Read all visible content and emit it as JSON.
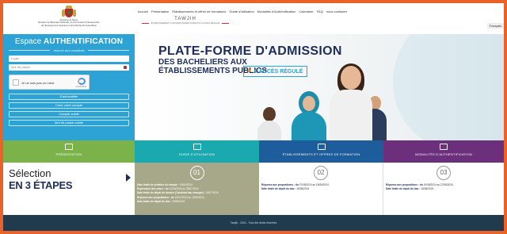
{
  "logo": {
    "lines": [
      "Royaume du Maroc",
      "Ministère de l'Éducation Nationale, de la Formation Professionnelle,",
      "de l'Enseignement Supérieur et de la Recherche Scientifique"
    ]
  },
  "topnav": [
    "Accueil",
    "Présentation",
    "Établissements et offres de formations",
    "Guide d'utilisation",
    "Modalités d'Authentification",
    "Calendrier",
    "FAQ",
    "nous contacter"
  ],
  "lang": "Français",
  "tawjih": {
    "name": "TAWJIH",
    "tag": "ÉTABLISSEMENTS UNIVERSITAIRES PUBLICS À ACCÈS RÉGULÉ"
  },
  "auth": {
    "title_prefix": "Espace",
    "title_bold": "AUTHENTIFICATION",
    "subtitle": "réservé aux candidats",
    "login_placeholder": "Login",
    "password_placeholder": "Mot de passe",
    "captcha_text": "Je ne suis pas un robot",
    "captcha_brand": "reCAPTCHA",
    "buttons": [
      "S'authentifier",
      "Créer votre compte",
      "Compte oublié",
      "Mot de passe oublié"
    ]
  },
  "hero": {
    "title": "PLATE-FORME D'ADMISSION",
    "subtitle_lines": [
      "DES BACHELIERS AUX",
      "ÉTABLISSEMENTS PUBLICS"
    ],
    "badge": "À ACCÈS RÉGULÉ"
  },
  "tabs": [
    "PRÉSENTATION",
    "GUIDE D'UTILISATION",
    "ÉTABLISSEMENTS ET OFFRES DE FORMATION",
    "MODALITÉS D'AUTHENTIFICATION"
  ],
  "selection": {
    "line1": "Sélection",
    "line2": "EN 3 ÉTAPES"
  },
  "steps": [
    {
      "number": "01",
      "rows": [
        {
          "label": "Date limite de création du compte :",
          "value": "03/06/2024"
        },
        {
          "label": "Expression des vœux : du",
          "value": "13/06/2024 au 28/07/2024"
        },
        {
          "label": "Date limite de dépôt du dossier (Candidat bac étranger) :",
          "value": "28/07/2024"
        },
        {
          "label": "Réponse aux propositions : du",
          "value": "15/07/2024 au 18/08/2024"
        },
        {
          "label": "Date limite de dépôt du bac :",
          "value": "18/08/2024"
        }
      ]
    },
    {
      "number": "02",
      "rows": [
        {
          "label": "Réponse aux propositions : du",
          "value": "07/08/2024 au 18/08/2024"
        },
        {
          "label": "Date limite de dépôt du bac :",
          "value": "18/08/2024"
        }
      ]
    },
    {
      "number": "03",
      "rows": [
        {
          "label": "Réponse aux propositions : du",
          "value": "19/08/2024 au 27/08/2024"
        },
        {
          "label": "Date limite de dépôt du bac :",
          "value": "18/08/2024"
        }
      ]
    }
  ],
  "footer": "Tawjih - 2024 - Tous les droits réservés",
  "colors": {
    "accent": "#2ca3d4",
    "frame": "#e9622a",
    "green": "#7bb34a",
    "teal": "#1ba9b0",
    "blue": "#1d5d9b",
    "purple": "#6b2f7b"
  }
}
